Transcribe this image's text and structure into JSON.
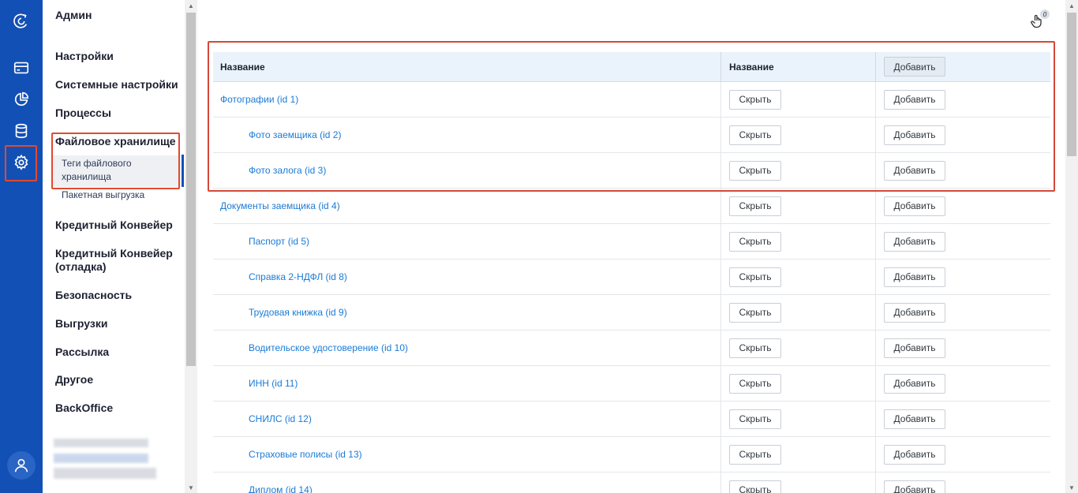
{
  "menu": {
    "title": "Админ",
    "items": [
      {
        "label": "Настройки"
      },
      {
        "label": "Системные настройки"
      },
      {
        "label": "Процессы"
      },
      {
        "label": "Файловое хранилище"
      },
      {
        "label": "Кредитный Конвейер"
      },
      {
        "label": "Кредитный Конвейер (отладка)"
      },
      {
        "label": "Безопасность"
      },
      {
        "label": "Выгрузки"
      },
      {
        "label": "Рассылка"
      },
      {
        "label": "Другое"
      },
      {
        "label": "BackOffice"
      }
    ],
    "subitems": [
      {
        "label": "Теги файлового хранилища",
        "active": true
      },
      {
        "label": "Пакетная выгрузка",
        "active": false
      }
    ]
  },
  "rail": {
    "icons": [
      "logo-icon",
      "card-icon",
      "pie-chart-icon",
      "database-icon",
      "gear-icon",
      "user-icon"
    ],
    "accent": "#1350b5"
  },
  "header": {
    "gesture_badge": "0"
  },
  "table": {
    "columns": [
      "Название",
      "Название",
      "Добавить"
    ],
    "hide_label": "Скрыть",
    "add_label": "Добавить",
    "rows": [
      {
        "name": "Фотографии (id 1)",
        "level": 0
      },
      {
        "name": "Фото заемщика (id 2)",
        "level": 1
      },
      {
        "name": "Фото залога (id 3)",
        "level": 1
      },
      {
        "name": "Документы заемщика (id 4)",
        "level": 0
      },
      {
        "name": "Паспорт (id 5)",
        "level": 1
      },
      {
        "name": "Справка 2-НДФЛ (id 8)",
        "level": 1
      },
      {
        "name": "Трудовая книжка (id 9)",
        "level": 1
      },
      {
        "name": "Водительское удостоверение (id 10)",
        "level": 1
      },
      {
        "name": "ИНН (id 11)",
        "level": 1
      },
      {
        "name": "СНИЛС (id 12)",
        "level": 1
      },
      {
        "name": "Страховые полисы (id 13)",
        "level": 1
      },
      {
        "name": "Диплом (id 14)",
        "level": 1
      }
    ]
  },
  "colors": {
    "link": "#1a7bd6",
    "highlight": "#d4473a",
    "header_bg": "#eaf3fb"
  }
}
